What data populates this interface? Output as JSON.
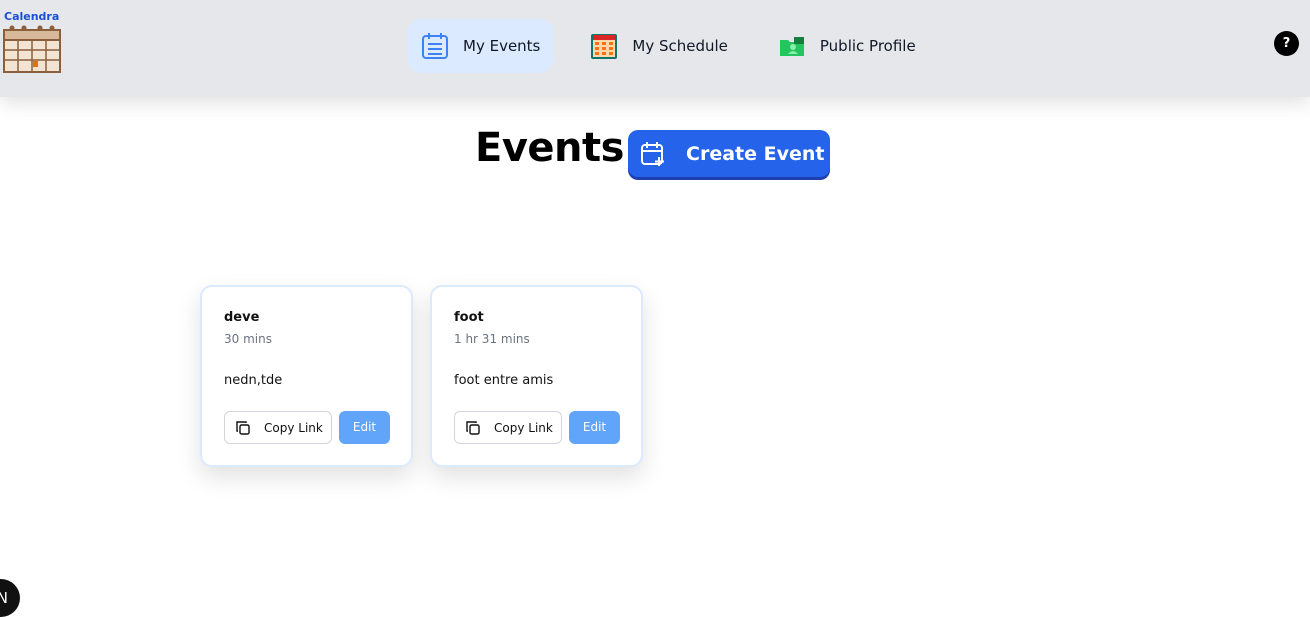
{
  "logo": {
    "text": "Calendra"
  },
  "nav": {
    "items": [
      {
        "label": "My Events",
        "icon": "calendar-list-icon",
        "active": true
      },
      {
        "label": "My Schedule",
        "icon": "calendar-grid-icon",
        "active": false
      },
      {
        "label": "Public Profile",
        "icon": "profile-folder-icon",
        "active": false
      }
    ]
  },
  "header": {
    "help_glyph": "?"
  },
  "main": {
    "title": "Events",
    "create_label": "Create Event"
  },
  "events": [
    {
      "title": "deve",
      "duration": "30 mins",
      "description": "nedn,tde",
      "copy_label": "Copy Link",
      "edit_label": "Edit"
    },
    {
      "title": "foot",
      "duration": "1 hr 31 mins",
      "description": "foot entre amis",
      "copy_label": "Copy Link",
      "edit_label": "Edit"
    }
  ],
  "dev_badge": {
    "text": "N"
  },
  "colors": {
    "primary": "#2563eb",
    "edit": "#60a5fa",
    "nav_active": "#dbeafe",
    "topbar": "#e5e7eb"
  }
}
